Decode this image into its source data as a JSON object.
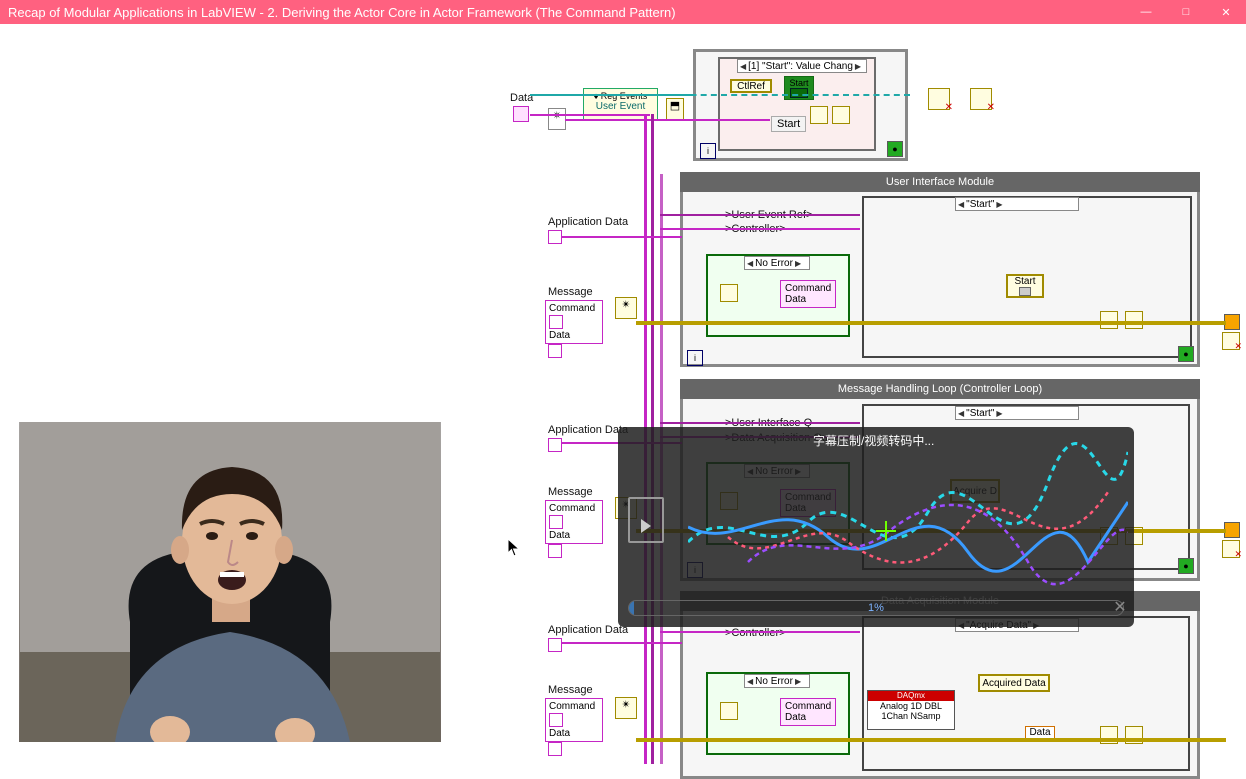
{
  "window": {
    "title": "Recap of Modular Applications in LabVIEW - 2. Deriving the Actor Core in Actor Framework (The Command Pattern)"
  },
  "labels": {
    "data_top": "Data",
    "reg_events": "Reg Events",
    "user_event": "User Event",
    "ctlref": "CtlRef",
    "start_top": "Start",
    "start_btn": "Start",
    "event_case": "[1] \"Start\": Value Chang",
    "ui_module": "User Interface Module",
    "user_event_ref": ">User Event Ref>",
    "controller": ">Controller>",
    "no_error": "No Error",
    "start_case": "\"Start\"",
    "ui_start_indicator": "Start",
    "command": "Command",
    "data": "Data",
    "message": "Message",
    "app_data": "Application Data",
    "mhl": "Message Handling Loop  (Controller Loop)",
    "user_interface_q": ">User Interface Q",
    "data_acq_q": ">Data Acquisition Queue>",
    "acquire_d": "Acquire D",
    "data_acq_module": "Data Acquisition Module",
    "acquire_data_case": "\"Acquire Data\"",
    "acquired_data": "Acquired Data",
    "analog": "Analog 1D DBL",
    "chan": "1Chan NSamp",
    "data_ind": "Data",
    "daqmx": "DAQmx"
  },
  "overlay": {
    "title": "字幕压制/视频转码中...",
    "progress_text": "1%"
  }
}
